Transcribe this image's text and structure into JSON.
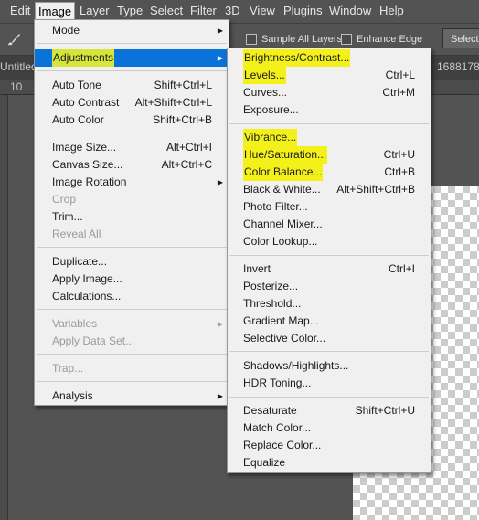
{
  "menubar": {
    "items": [
      "Edit",
      "Image",
      "Layer",
      "Type",
      "Select",
      "Filter",
      "3D",
      "View",
      "Plugins",
      "Window",
      "Help"
    ]
  },
  "options_bar": {
    "sample_all_layers": "Sample All Layers",
    "enhance_edge": "Enhance Edge",
    "select_button": "Select S"
  },
  "document": {
    "tab_title": "Untitled",
    "tab_right": "1688178",
    "ruler_label": "10"
  },
  "image_menu": {
    "items": [
      {
        "label": "Mode",
        "shortcut": "",
        "submenu": true,
        "disabled": false
      },
      {
        "label": "Adjustments",
        "shortcut": "",
        "submenu": true,
        "disabled": false,
        "selected": true
      },
      {
        "label": "Auto Tone",
        "shortcut": "Shift+Ctrl+L",
        "disabled": false
      },
      {
        "label": "Auto Contrast",
        "shortcut": "Alt+Shift+Ctrl+L",
        "disabled": false
      },
      {
        "label": "Auto Color",
        "shortcut": "Shift+Ctrl+B",
        "disabled": false
      },
      {
        "label": "Image Size...",
        "shortcut": "Alt+Ctrl+I",
        "disabled": false
      },
      {
        "label": "Canvas Size...",
        "shortcut": "Alt+Ctrl+C",
        "disabled": false
      },
      {
        "label": "Image Rotation",
        "shortcut": "",
        "submenu": true,
        "disabled": false
      },
      {
        "label": "Crop",
        "shortcut": "",
        "disabled": true
      },
      {
        "label": "Trim...",
        "shortcut": "",
        "disabled": false
      },
      {
        "label": "Reveal All",
        "shortcut": "",
        "disabled": true
      },
      {
        "label": "Duplicate...",
        "shortcut": "",
        "disabled": false
      },
      {
        "label": "Apply Image...",
        "shortcut": "",
        "disabled": false
      },
      {
        "label": "Calculations...",
        "shortcut": "",
        "disabled": false
      },
      {
        "label": "Variables",
        "shortcut": "",
        "submenu": true,
        "disabled": true
      },
      {
        "label": "Apply Data Set...",
        "shortcut": "",
        "disabled": true
      },
      {
        "label": "Trap...",
        "shortcut": "",
        "disabled": true
      },
      {
        "label": "Analysis",
        "shortcut": "",
        "submenu": true,
        "disabled": false
      }
    ]
  },
  "adjustments_menu": {
    "items": [
      {
        "label": "Brightness/Contrast...",
        "shortcut": "",
        "highlighted": true
      },
      {
        "label": "Levels...",
        "shortcut": "Ctrl+L",
        "highlighted": true
      },
      {
        "label": "Curves...",
        "shortcut": "Ctrl+M",
        "highlighted": false
      },
      {
        "label": "Exposure...",
        "shortcut": "",
        "highlighted": false
      },
      {
        "label": "Vibrance...",
        "shortcut": "",
        "highlighted": true
      },
      {
        "label": "Hue/Saturation...",
        "shortcut": "Ctrl+U",
        "highlighted": true
      },
      {
        "label": "Color Balance...",
        "shortcut": "Ctrl+B",
        "highlighted": true
      },
      {
        "label": "Black & White...",
        "shortcut": "Alt+Shift+Ctrl+B",
        "highlighted": false
      },
      {
        "label": "Photo Filter...",
        "shortcut": "",
        "highlighted": false
      },
      {
        "label": "Channel Mixer...",
        "shortcut": "",
        "highlighted": false
      },
      {
        "label": "Color Lookup...",
        "shortcut": "",
        "highlighted": false
      },
      {
        "label": "Invert",
        "shortcut": "Ctrl+I",
        "highlighted": false
      },
      {
        "label": "Posterize...",
        "shortcut": "",
        "highlighted": false
      },
      {
        "label": "Threshold...",
        "shortcut": "",
        "highlighted": false
      },
      {
        "label": "Gradient Map...",
        "shortcut": "",
        "highlighted": false
      },
      {
        "label": "Selective Color...",
        "shortcut": "",
        "highlighted": false
      },
      {
        "label": "Shadows/Highlights...",
        "shortcut": "",
        "highlighted": false
      },
      {
        "label": "HDR Toning...",
        "shortcut": "",
        "highlighted": false
      },
      {
        "label": "Desaturate",
        "shortcut": "Shift+Ctrl+U",
        "highlighted": false
      },
      {
        "label": "Match Color...",
        "shortcut": "",
        "highlighted": false
      },
      {
        "label": "Replace Color...",
        "shortcut": "",
        "highlighted": false
      },
      {
        "label": "Equalize",
        "shortcut": "",
        "highlighted": false
      }
    ]
  },
  "colors": {
    "selected_bg": "#0a73d9",
    "marker_yellow": "#f3f01a",
    "marker_green": "#d6e53a",
    "workspace": "#535353"
  }
}
